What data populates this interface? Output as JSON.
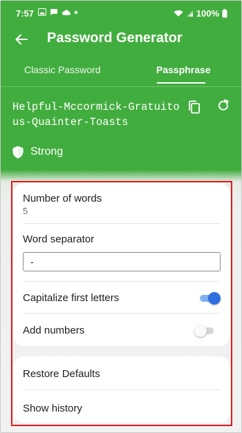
{
  "status_bar": {
    "time": "7:57",
    "battery": "100%",
    "icons": [
      "image-icon",
      "message-icon",
      "cloud-icon",
      "dot-icon",
      "wifi-icon",
      "signal-icon",
      "battery-icon"
    ]
  },
  "app_bar": {
    "title": "Password Generator",
    "back_icon": "arrow-left-icon"
  },
  "tabs": [
    {
      "label": "Classic Password",
      "selected": false
    },
    {
      "label": "Passphrase",
      "selected": true
    }
  ],
  "password": {
    "value": "Helpful-Mccormick-Gratuitous-Quainter-Toasts",
    "copy_icon": "copy-icon",
    "regenerate_icon": "refresh-icon"
  },
  "strength": {
    "label": "Strong",
    "icon": "shield-icon"
  },
  "settings": {
    "number_of_words": {
      "label": "Number of words",
      "value": "5"
    },
    "word_separator": {
      "label": "Word separator",
      "value": "-"
    },
    "capitalize": {
      "label": "Capitalize first letters",
      "enabled": true
    },
    "add_numbers": {
      "label": "Add numbers",
      "enabled": false
    }
  },
  "actions": {
    "restore_defaults": "Restore Defaults",
    "show_history": "Show history"
  },
  "colors": {
    "primary": "#42ad3f",
    "toggle_on": "#2d6fe0",
    "highlight": "#e2181f"
  }
}
